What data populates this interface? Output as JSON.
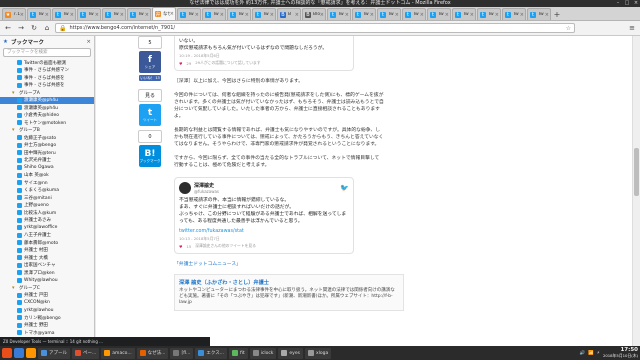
{
  "window": {
    "title": "なぜ法律ではは成功を外 約13万件, 弁護士への相談的な「懲戒請求」を考える：弁護士ドットコム - Mozilla Firefox",
    "controls": [
      "–",
      "□",
      "×"
    ]
  },
  "tabs": [
    {
      "label": "7.1",
      "color": "#f08a24",
      "glyph": "★",
      "active": false
    },
    {
      "label": "Tw",
      "color": "#1da1f2",
      "glyph": "t",
      "active": false
    },
    {
      "label": "Tw",
      "color": "#1da1f2",
      "glyph": "t",
      "active": false
    },
    {
      "label": "Tw",
      "color": "#1da1f2",
      "glyph": "t",
      "active": false
    },
    {
      "label": "Tw",
      "color": "#1da1f2",
      "glyph": "t",
      "active": false
    },
    {
      "label": "Tw",
      "color": "#1da1f2",
      "glyph": "t",
      "active": false
    },
    {
      "label": "なぜ",
      "color": "#f08a24",
      "glyph": "弁",
      "active": true
    },
    {
      "label": "Tw",
      "color": "#1da1f2",
      "glyph": "t",
      "active": false
    },
    {
      "label": "Tw",
      "color": "#1da1f2",
      "glyph": "t",
      "active": false
    },
    {
      "label": "Tw",
      "color": "#1da1f2",
      "glyph": "t",
      "active": false
    },
    {
      "label": "Tw",
      "color": "#1da1f2",
      "glyph": "t",
      "active": false
    },
    {
      "label": "B",
      "color": "#2a6ac9",
      "glyph": "B",
      "active": false
    },
    {
      "label": "Blo",
      "color": "#555555",
      "glyph": "B",
      "active": false
    },
    {
      "label": "Tw",
      "color": "#1da1f2",
      "glyph": "t",
      "active": false
    },
    {
      "label": "Tw",
      "color": "#1da1f2",
      "glyph": "t",
      "active": false
    },
    {
      "label": "Tw",
      "color": "#1da1f2",
      "glyph": "t",
      "active": false
    },
    {
      "label": "Tw",
      "color": "#1da1f2",
      "glyph": "t",
      "active": false
    },
    {
      "label": "Tw",
      "color": "#1da1f2",
      "glyph": "t",
      "active": false
    },
    {
      "label": "Tw",
      "color": "#1da1f2",
      "glyph": "t",
      "active": false
    },
    {
      "label": "Tw",
      "color": "#1da1f2",
      "glyph": "t",
      "active": false
    },
    {
      "label": "Tw",
      "color": "#1da1f2",
      "glyph": "t",
      "active": false
    },
    {
      "label": "Tw",
      "color": "#1da1f2",
      "glyph": "t",
      "active": false
    }
  ],
  "nav": {
    "back": "←",
    "forward": "→",
    "reload": "↻",
    "home": "⌂",
    "url": "https://www.bengo4.com/internet/n_7901/",
    "menu": "≡"
  },
  "sidebar": {
    "title": "ブックマーク",
    "close": "×",
    "search_placeholder": "ブックマークを検索",
    "items": [
      {
        "text": "Twitterの画面も観測",
        "kind": "tw",
        "sel": false
      },
      {
        "text": "事件 - さらば共感マン",
        "kind": "tw",
        "sel": false
      },
      {
        "text": "事件 - さらば共感を",
        "kind": "tw",
        "sel": false
      },
      {
        "text": "事件 - さらば共感を",
        "kind": "tw",
        "sel": false
      },
      {
        "text": "グループA",
        "kind": "folder",
        "sel": false
      },
      {
        "text": "渡瀬康英@ph4u",
        "kind": "tw",
        "sel": true
      },
      {
        "text": "渡瀬康英@ph4u",
        "kind": "tw",
        "sel": false
      },
      {
        "text": "小倉秀夫@hideo",
        "kind": "tw",
        "sel": false
      },
      {
        "text": "モトケン@motoken",
        "kind": "tw",
        "sel": false
      },
      {
        "text": "グループB",
        "kind": "folder",
        "sel": false
      },
      {
        "text": "佐藤正子@sato",
        "kind": "tw",
        "sel": false
      },
      {
        "text": "弁士方@bengo",
        "kind": "tw",
        "sel": false
      },
      {
        "text": "田中輝光@teru",
        "kind": "tw",
        "sel": false
      },
      {
        "text": "北沢光弁護士",
        "kind": "tw",
        "sel": false
      },
      {
        "text": "Shiho Ogawa",
        "kind": "tw",
        "sel": false
      },
      {
        "text": "山本 英@ok",
        "kind": "tw",
        "sel": false
      },
      {
        "text": "サイエ@nn",
        "kind": "tw",
        "sel": false
      },
      {
        "text": "くまくろ@kuma",
        "kind": "tw",
        "sel": false
      },
      {
        "text": "三谷@mitani",
        "kind": "tw",
        "sel": false
      },
      {
        "text": "上野@ueno",
        "kind": "tw",
        "sel": false
      },
      {
        "text": "比較法人@kum",
        "kind": "tw",
        "sel": false
      },
      {
        "text": "弁護士あさみ",
        "kind": "tw",
        "sel": false
      },
      {
        "text": "yrkt@lawoffice",
        "kind": "tw",
        "sel": false
      },
      {
        "text": "八王子弁護士",
        "kind": "tw",
        "sel": false
      },
      {
        "text": "藤本壽郎@moto",
        "kind": "tw",
        "sel": false
      },
      {
        "text": "弁護士 村田",
        "kind": "tw",
        "sel": false
      },
      {
        "text": "弁護士 大橋",
        "kind": "tw",
        "sel": false
      },
      {
        "text": "出家国ベンチャ",
        "kind": "tw",
        "sel": false
      },
      {
        "text": "黒澤プロ@ken",
        "kind": "tw",
        "sel": false
      },
      {
        "text": "Whity@lawhou",
        "kind": "tw",
        "sel": false
      },
      {
        "text": "グループC",
        "kind": "folder",
        "sel": false
      },
      {
        "text": "弁護士 戸田",
        "kind": "tw",
        "sel": false
      },
      {
        "text": "CXCON@kn",
        "kind": "tw",
        "sel": false
      },
      {
        "text": "yrkt@lawhou",
        "kind": "tw",
        "sel": false
      },
      {
        "text": "カリン戦@bengo",
        "kind": "tw",
        "sel": false
      },
      {
        "text": "弁護士 野田",
        "kind": "tw",
        "sel": false
      },
      {
        "text": "トマホ@yama",
        "kind": "tw",
        "sel": false
      },
      {
        "text": "遠藤光男@rtt",
        "kind": "tw",
        "sel": false
      }
    ]
  },
  "share": {
    "count_top": "5",
    "facebook": {
      "glyph": "f",
      "label": "シェア",
      "color": "#3b5998"
    },
    "like": "いいね！ 13",
    "count_mid": "見る",
    "twitter": {
      "glyph": "t",
      "label": "ツイート",
      "color": "#1da1f2"
    },
    "count_low": "0",
    "hatena": {
      "glyph": "B!",
      "label": "ブックマーク",
      "color": "#008fde"
    }
  },
  "article": {
    "quote": {
      "text": "いない。\n原伝懲戒請求もちろん気が付いているはずなので問題なしだろうが。",
      "meta": "10:19 - 2018年5月6日",
      "likes": "29",
      "likes_text": "29人がこの話題について話しています"
    },
    "para1": "［深澤］以上に加え、今回はさらに特別の事情があります。",
    "para2": "今回の件については、何者な組織を持ったのに被告発(懲戒請求をした側)にも、標的ゲームを抜がされいます。多くの弁護士は気が付いていなかったはず、もちろそう、弁護士は読み込もうとで自分について気配していました。いたした事者の方から、弁護士に直接相談されることもありますよ。",
    "para3": "長期的な利益とは閲覧する情報であれば、弁護士も気になりやすいのですが。具体的な紛争、しかも現在進行している事件については、懲戒によって、かたろうからもう、きちんと答えていなくてはなりません。そうやらわけで、非専門家の懲戒請求件が発覚されるということになります。",
    "para4": "ですから、今回に限らず、全ての事件の当たる全的なトラブルについて、ネットで情報目撃して行動することは、極めて危険だと考えます。",
    "tweet": {
      "name": "深澤諭史",
      "handle": "@fukazawas",
      "body": "不当懲戒請求の件、本当に情報が錯綜しているな。\nまあ、すぐに弁護士に相談すればいいだけの話だが。\nぶっちゃけ、この分野について経験がある弁護士であれば、相解を送ってしまっても、ある程度共通した最善手は浮かんでいると思う。",
      "link": "twitter.com/fukazawas/stat",
      "meta": "10:13 - 2018年5月7日",
      "likes": "15",
      "likes_text": "深澤諭史さんの他のツイートを見る"
    },
    "series_link": "「弁護士ドットコムニュース」",
    "profile": {
      "name": "深澤 諭史（ふかざわ・さとし）弁護士",
      "desc": "ネットやコンピューターにまつわる法律事件を中心に取り扱う。ネット関連の法律では関係者向けの講演なども実施。著書に「その「つぶやき」は犯罪です」(新潮、新潮新書)ほか。所属ウェブサイト：http://f-b-law.jp"
    }
  },
  "devstrip": "Z0 Developer Tools — terminal :: 14 git nothing ...",
  "taskbar": {
    "items": [
      {
        "label": "アプール",
        "color": "#4a90d9"
      },
      {
        "label": "ペー...",
        "color": "#e24f2c"
      },
      {
        "label": "amaco...",
        "color": "#ff9900"
      },
      {
        "label": "なぜ法...",
        "color": "#e66000"
      },
      {
        "label": "[fl...",
        "color": "#777777"
      },
      {
        "label": "エクス...",
        "color": "#3c8dd8"
      },
      {
        "label": "fit",
        "color": "#5cb85c"
      },
      {
        "label": "iclock",
        "color": "#888888"
      },
      {
        "label": "eyes",
        "color": "#aaaaaa"
      },
      {
        "label": "xloga",
        "color": "#999999"
      }
    ],
    "tray": [
      "🔊",
      "📶",
      "⚡"
    ],
    "time": "17:50",
    "date": "2018年5月10日(木)"
  }
}
